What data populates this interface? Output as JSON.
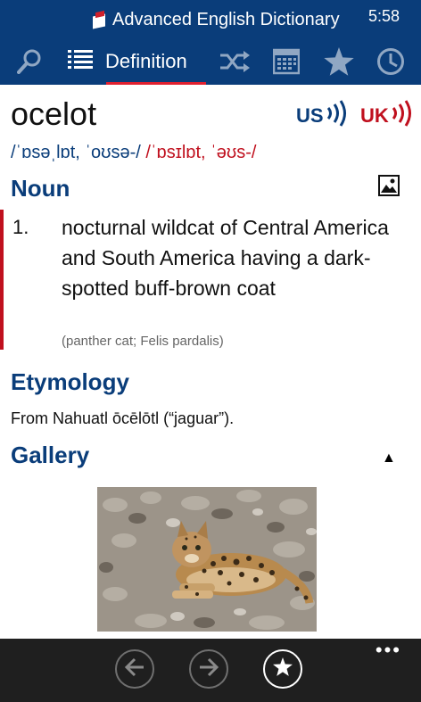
{
  "header": {
    "app_title": "Advanced English Dictionary",
    "time": "5:58",
    "active_tab": "Definition"
  },
  "entry": {
    "word": "ocelot",
    "audio_us_label": "US",
    "audio_uk_label": "UK",
    "pron_us": "/ˈɒsəˌlɒt, ˈoʊsə-/",
    "pron_uk": "/ˈɒsɪlɒt, ˈəʊs-/"
  },
  "noun": {
    "heading": "Noun",
    "definitions": [
      {
        "number": "1.",
        "text": "nocturnal wildcat of Central America and South America having a dark-spotted buff-brown coat",
        "synonyms": "(panther cat; Felis pardalis)"
      }
    ]
  },
  "etymology": {
    "heading": "Etymology",
    "text": "From Nahuatl ōcēlōtl (“jaguar”)."
  },
  "gallery": {
    "heading": "Gallery"
  },
  "colors": {
    "header_bg": "#0a3d7a",
    "accent_red": "#c0101e",
    "appbar_bg": "#1f1f1f"
  },
  "icons": {
    "toolbar": [
      "search-icon",
      "list-icon",
      "shuffle-icon",
      "calendar-icon",
      "star-icon",
      "clock-icon"
    ],
    "appbar": [
      "back-arrow-icon",
      "forward-arrow-icon",
      "favorite-star-icon",
      "more-icon"
    ]
  }
}
